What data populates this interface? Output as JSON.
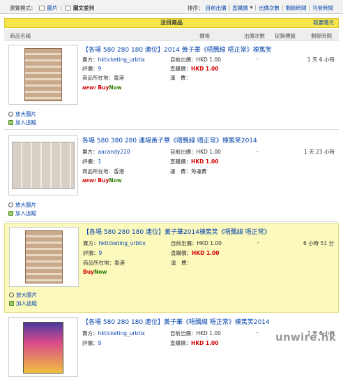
{
  "toolbar": {
    "view_mode_label": "瀏覽模式：",
    "view_image": "圖片",
    "view_list": "圖文並列",
    "sort_label": "排序：",
    "sort_options": [
      "目前出價",
      "直購價",
      "出價次數",
      "剩餘時間",
      "刊登時間"
    ]
  },
  "banner": {
    "title": "注目商品",
    "expose": "我要曝光"
  },
  "columns": {
    "name": "商品名稱",
    "price": "價格",
    "bids": "出價次數",
    "promo": "促銷標籤",
    "time": "剩餘時間"
  },
  "labels": {
    "seller": "賣方：",
    "rating": "評價：",
    "location": "商品所在地：",
    "current_bid": "目前出價：",
    "buy_price": "直購價：",
    "shipping": "運　費：",
    "enlarge": "放大圖片",
    "watch": "加入追蹤",
    "new": "NEW!",
    "buy": "Buy",
    "now": "Now"
  },
  "listings": [
    {
      "title": "【各場 580 280 180 連位】2014 黃子華《唔飄線 唔正常》棟篤笑",
      "seller": "hkticketing_urbtix",
      "rating": "9",
      "location": "香港",
      "current_bid": "HKD 1.00",
      "buy_price": "HKD 1.00",
      "bids": "-",
      "time_left": "1 天 6 小時",
      "shipping": "",
      "thumb_alt": "門票相片"
    },
    {
      "title": "各場 580 380 280 連場黃子華《唔飄線 唔正常》棟篤笑2014",
      "seller": "aacandy220",
      "rating": "1",
      "location": "香港",
      "current_bid": "HKD 1.00",
      "buy_price": "HKD 1.00",
      "bids": "-",
      "time_left": "1 天 23 小時",
      "shipping": "免運費",
      "thumb_alt": "門票相片"
    },
    {
      "title": "【各場 580 280 180 連位】黃子華2014棟篤笑《唔飄線 唔正常》",
      "seller": "hkticketing_urbtix",
      "rating": "9",
      "location": "香港",
      "current_bid": "HKD 1.00",
      "buy_price": "HKD 1.00",
      "bids": "-",
      "time_left": "6 小時 51 分",
      "shipping": "",
      "thumb_alt": "門票相片"
    },
    {
      "title": "【各場 580 280 180 連位】黃子華《唔飄線 唔正常》棟篤笑2014",
      "seller": "hkticketing_urbtix",
      "rating": "9",
      "location": "",
      "current_bid": "HKD 1.00",
      "buy_price": "HKD 1.00",
      "bids": "-",
      "time_left": "1 天 6 小時",
      "shipping": "",
      "thumb_alt": "海報相片"
    }
  ],
  "watermark": "unwire.hk"
}
